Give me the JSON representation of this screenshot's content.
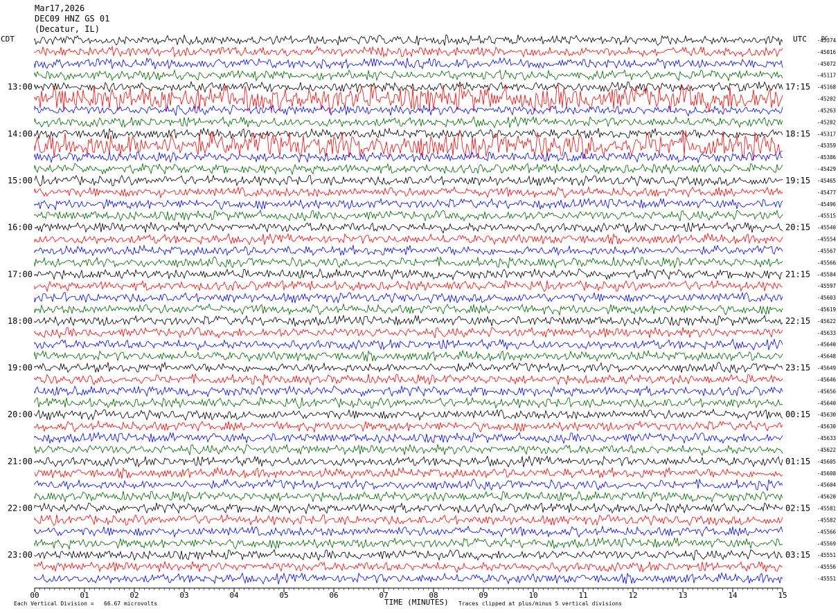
{
  "header": {
    "date": "Mar17,2026",
    "station": "DEC09 HNZ GS 01",
    "location": "(Decatur, IL)"
  },
  "chart_data": {
    "type": "line",
    "title": "Mar17,2026 DEC09 HNZ GS 01 (Decatur, IL)",
    "xlabel": "TIME (MINUTES)",
    "ylabel_left": "CDT",
    "ylabel_right": "UTC",
    "dc_label": "DC",
    "x_ticks": [
      "00",
      "01",
      "02",
      "03",
      "04",
      "05",
      "06",
      "07",
      "08",
      "09",
      "10",
      "11",
      "12",
      "13",
      "14",
      "15"
    ],
    "xlim": [
      0,
      15
    ],
    "left_hour_labels": [
      "13:00",
      "14:00",
      "15:00",
      "16:00",
      "17:00",
      "18:00",
      "19:00",
      "20:00",
      "21:00",
      "22:00",
      "23:00"
    ],
    "right_hour_labels": [
      "17:15",
      "18:15",
      "19:15",
      "20:15",
      "21:15",
      "22:15",
      "23:15",
      "00:15",
      "01:15",
      "02:15",
      "03:15"
    ],
    "trace_colors": [
      "#000000",
      "#ff0000",
      "#0000ff",
      "#006400"
    ],
    "dc_offsets": [
      "-45374",
      "-45016",
      "-45072",
      "-45117",
      "-45168",
      "-45202",
      "-45263",
      "-45282",
      "-45317",
      "-45359",
      "-45386",
      "-45429",
      "-45465",
      "-45477",
      "-45496",
      "-45515",
      "-45540",
      "-45554",
      "-45567",
      "-45566",
      "-45584",
      "-45597",
      "-45603",
      "-45619",
      "-45622",
      "-45633",
      "-45640",
      "-45648",
      "-45649",
      "-45646",
      "-45656",
      "-45640",
      "-45630",
      "-45630",
      "-45633",
      "-45622",
      "-45605",
      "-45608",
      "-45604",
      "-45620",
      "-45581",
      "-45582",
      "-45566",
      "-45569",
      "-45551",
      "-45556",
      "-45551"
    ],
    "trace_count": 47,
    "footer_left": "Each Vertical Division =   66.67 microvolts",
    "footer_right": "Traces clipped at plus/minus 5 vertical divisions"
  }
}
